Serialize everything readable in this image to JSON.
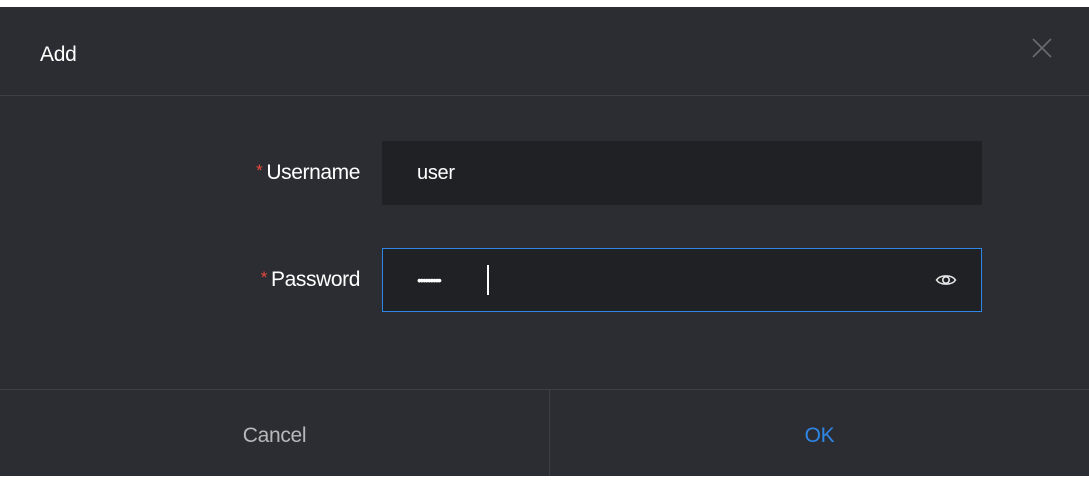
{
  "dialog": {
    "title": "Add",
    "close_icon": "close-icon"
  },
  "form": {
    "username": {
      "required_mark": "*",
      "label": "Username",
      "value": "user"
    },
    "password": {
      "required_mark": "*",
      "label": "Password",
      "masked_value": "•••••••••",
      "reveal_icon": "eye-icon"
    }
  },
  "footer": {
    "cancel_label": "Cancel",
    "ok_label": "OK"
  },
  "colors": {
    "background": "#2c2d32",
    "input_background": "#202125",
    "accent": "#2f86e6",
    "required": "#e8483c",
    "divider": "#3e3f44"
  }
}
